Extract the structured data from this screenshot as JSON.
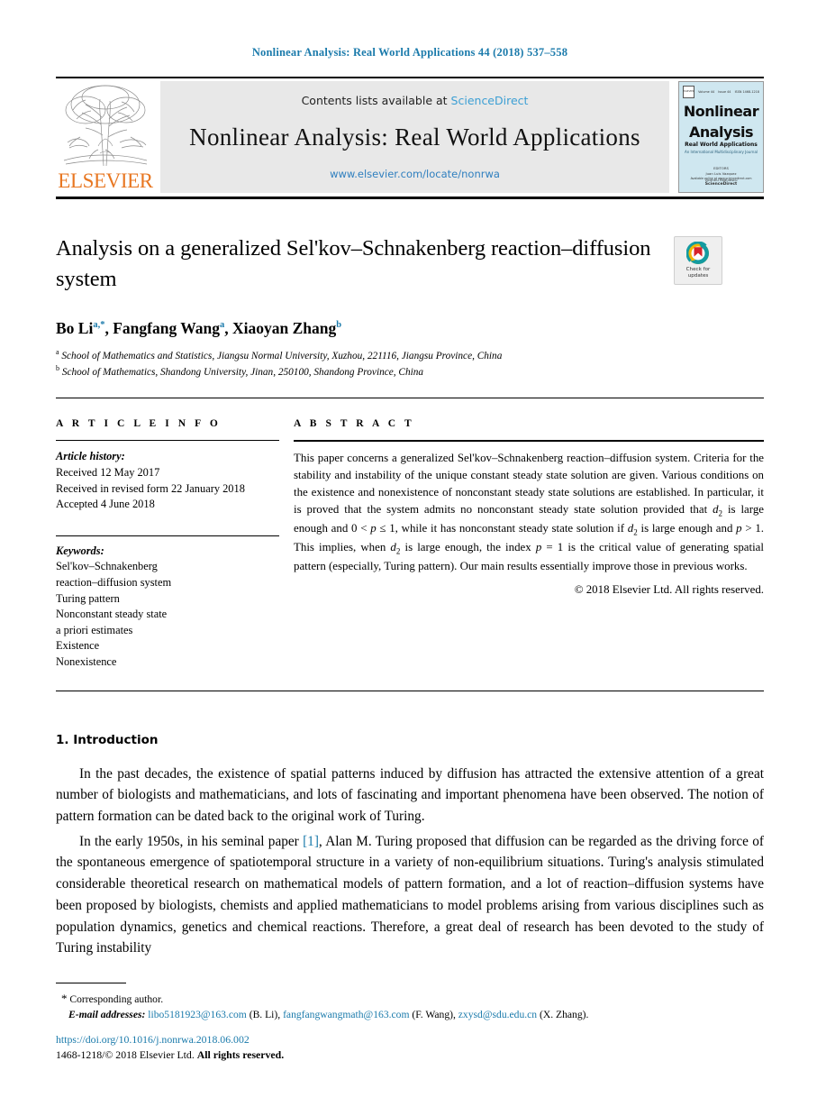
{
  "running_head": "Nonlinear Analysis: Real World Applications 44 (2018) 537–558",
  "masthead": {
    "publisher_wordmark": "ELSEVIER",
    "contents_prefix": "Contents lists available at ",
    "sciencedirect": "ScienceDirect",
    "journal_title": "Nonlinear Analysis: Real World Applications",
    "journal_url": "www.elsevier.com/locate/nonrwa",
    "cover": {
      "volume": "Volume 44",
      "issue": "Issue 44",
      "issn": "ISSN 1468-1218",
      "logo_text": "ELSEVIER",
      "title_line1": "Nonlinear",
      "title_line2": "Analysis",
      "subtitle": "Real World Applications",
      "subtitle2": "An International Multidisciplinary Journal",
      "editors_label": "EDITORS",
      "editor1": "Juan Luis Vazquez",
      "editor2": "Vicentiu Radulescu",
      "footer_line": "Available online at www.sciencedirect.com",
      "footer_brand": "ScienceDirect"
    }
  },
  "article": {
    "title": "Analysis on a generalized Sel'kov–Schnakenberg reaction–diffusion system",
    "crossmark_label_line1": "Check for",
    "crossmark_label_line2": "updates",
    "authors": [
      {
        "name": "Bo Li",
        "marks": "a",
        "corresponding": true
      },
      {
        "name": "Fangfang Wang",
        "marks": "a",
        "corresponding": false
      },
      {
        "name": "Xiaoyan Zhang",
        "marks": "b",
        "corresponding": false
      }
    ],
    "affiliation_a": "School of Mathematics and Statistics, Jiangsu Normal University, Xuzhou, 221116, Jiangsu Province, China",
    "affiliation_b": "School of Mathematics, Shandong University, Jinan, 250100, Shandong Province, China"
  },
  "article_info": {
    "heading": "A R T I C L E   I N F O",
    "history_label": "Article history:",
    "history": [
      "Received 12 May 2017",
      "Received in revised form 22 January 2018",
      "Accepted 4 June 2018"
    ],
    "keywords_label": "Keywords:",
    "keywords": [
      "Sel'kov–Schnakenberg",
      "reaction–diffusion system",
      "Turing pattern",
      "Nonconstant steady state",
      "a priori estimates",
      "Existence",
      "Nonexistence"
    ]
  },
  "abstract": {
    "heading": "A B S T R A C T",
    "part1": "This paper concerns a generalized Sel'kov–Schnakenberg reaction–diffusion system. Criteria for the stability and instability of the unique constant steady state solution are given. Various conditions on the existence and nonexistence of nonconstant steady state solutions are established. In particular, it is proved that the system admits no nonconstant steady state solution provided that ",
    "math1": "d",
    "math1_sub": "2",
    "part2": " is large enough and 0 < ",
    "math2": "p",
    "part3": " ≤ 1, while it has nonconstant steady state solution if ",
    "math3": "d",
    "math3_sub": "2",
    "part4": " is large enough and ",
    "math4": "p",
    "part5": " > 1. This implies, when ",
    "math5": "d",
    "math5_sub": "2",
    "part6": " is large enough, the index ",
    "math6": "p",
    "part7": " = 1 is the critical value of generating spatial pattern (especially, Turing pattern). Our main results essentially improve those in previous works.",
    "copyright": "© 2018 Elsevier Ltd. All rights reserved."
  },
  "body": {
    "section_heading": "1.  Introduction",
    "paragraph1": "In the past decades, the existence of spatial patterns induced by diffusion has attracted the extensive attention of a great number of biologists and mathematicians, and lots of fascinating and important phenomena have been observed. The notion of pattern formation can be dated back to the original work of Turing.",
    "paragraph2_before": "In the early 1950s, in his seminal paper ",
    "paragraph2_cite": "[1]",
    "paragraph2_after": ", Alan M. Turing proposed that diffusion can be regarded as the driving force of the spontaneous emergence of spatiotemporal structure in a variety of non-equilibrium situations. Turing's analysis stimulated considerable theoretical research on mathematical models of pattern formation, and a lot of reaction–diffusion systems have been proposed by biologists, chemists and applied mathematicians to model problems arising from various disciplines such as population dynamics, genetics and chemical reactions. Therefore, a great deal of research has been devoted to the study of Turing instability"
  },
  "footnotes": {
    "corresponding_star": "*",
    "corresponding_text": "Corresponding author.",
    "email_label": "E-mail addresses:",
    "emails": [
      {
        "address": "libo5181923@163.com",
        "owner": "(B. Li)"
      },
      {
        "address": "fangfangwangmath@163.com",
        "owner": "(F. Wang)"
      },
      {
        "address": "zxysd@sdu.edu.cn",
        "owner": "(X. Zhang)"
      }
    ],
    "doi": "https://doi.org/10.1016/j.nonrwa.2018.06.002",
    "issn_prefix": "1468-1218/© 2018 Elsevier Ltd. ",
    "issn_rights": "All rights reserved."
  },
  "colors": {
    "link_blue": "#1a7aab",
    "sciencedirect_blue": "#3c9fd4",
    "elsevier_orange": "#E87722",
    "cover_bg": "#cfe7f0"
  }
}
